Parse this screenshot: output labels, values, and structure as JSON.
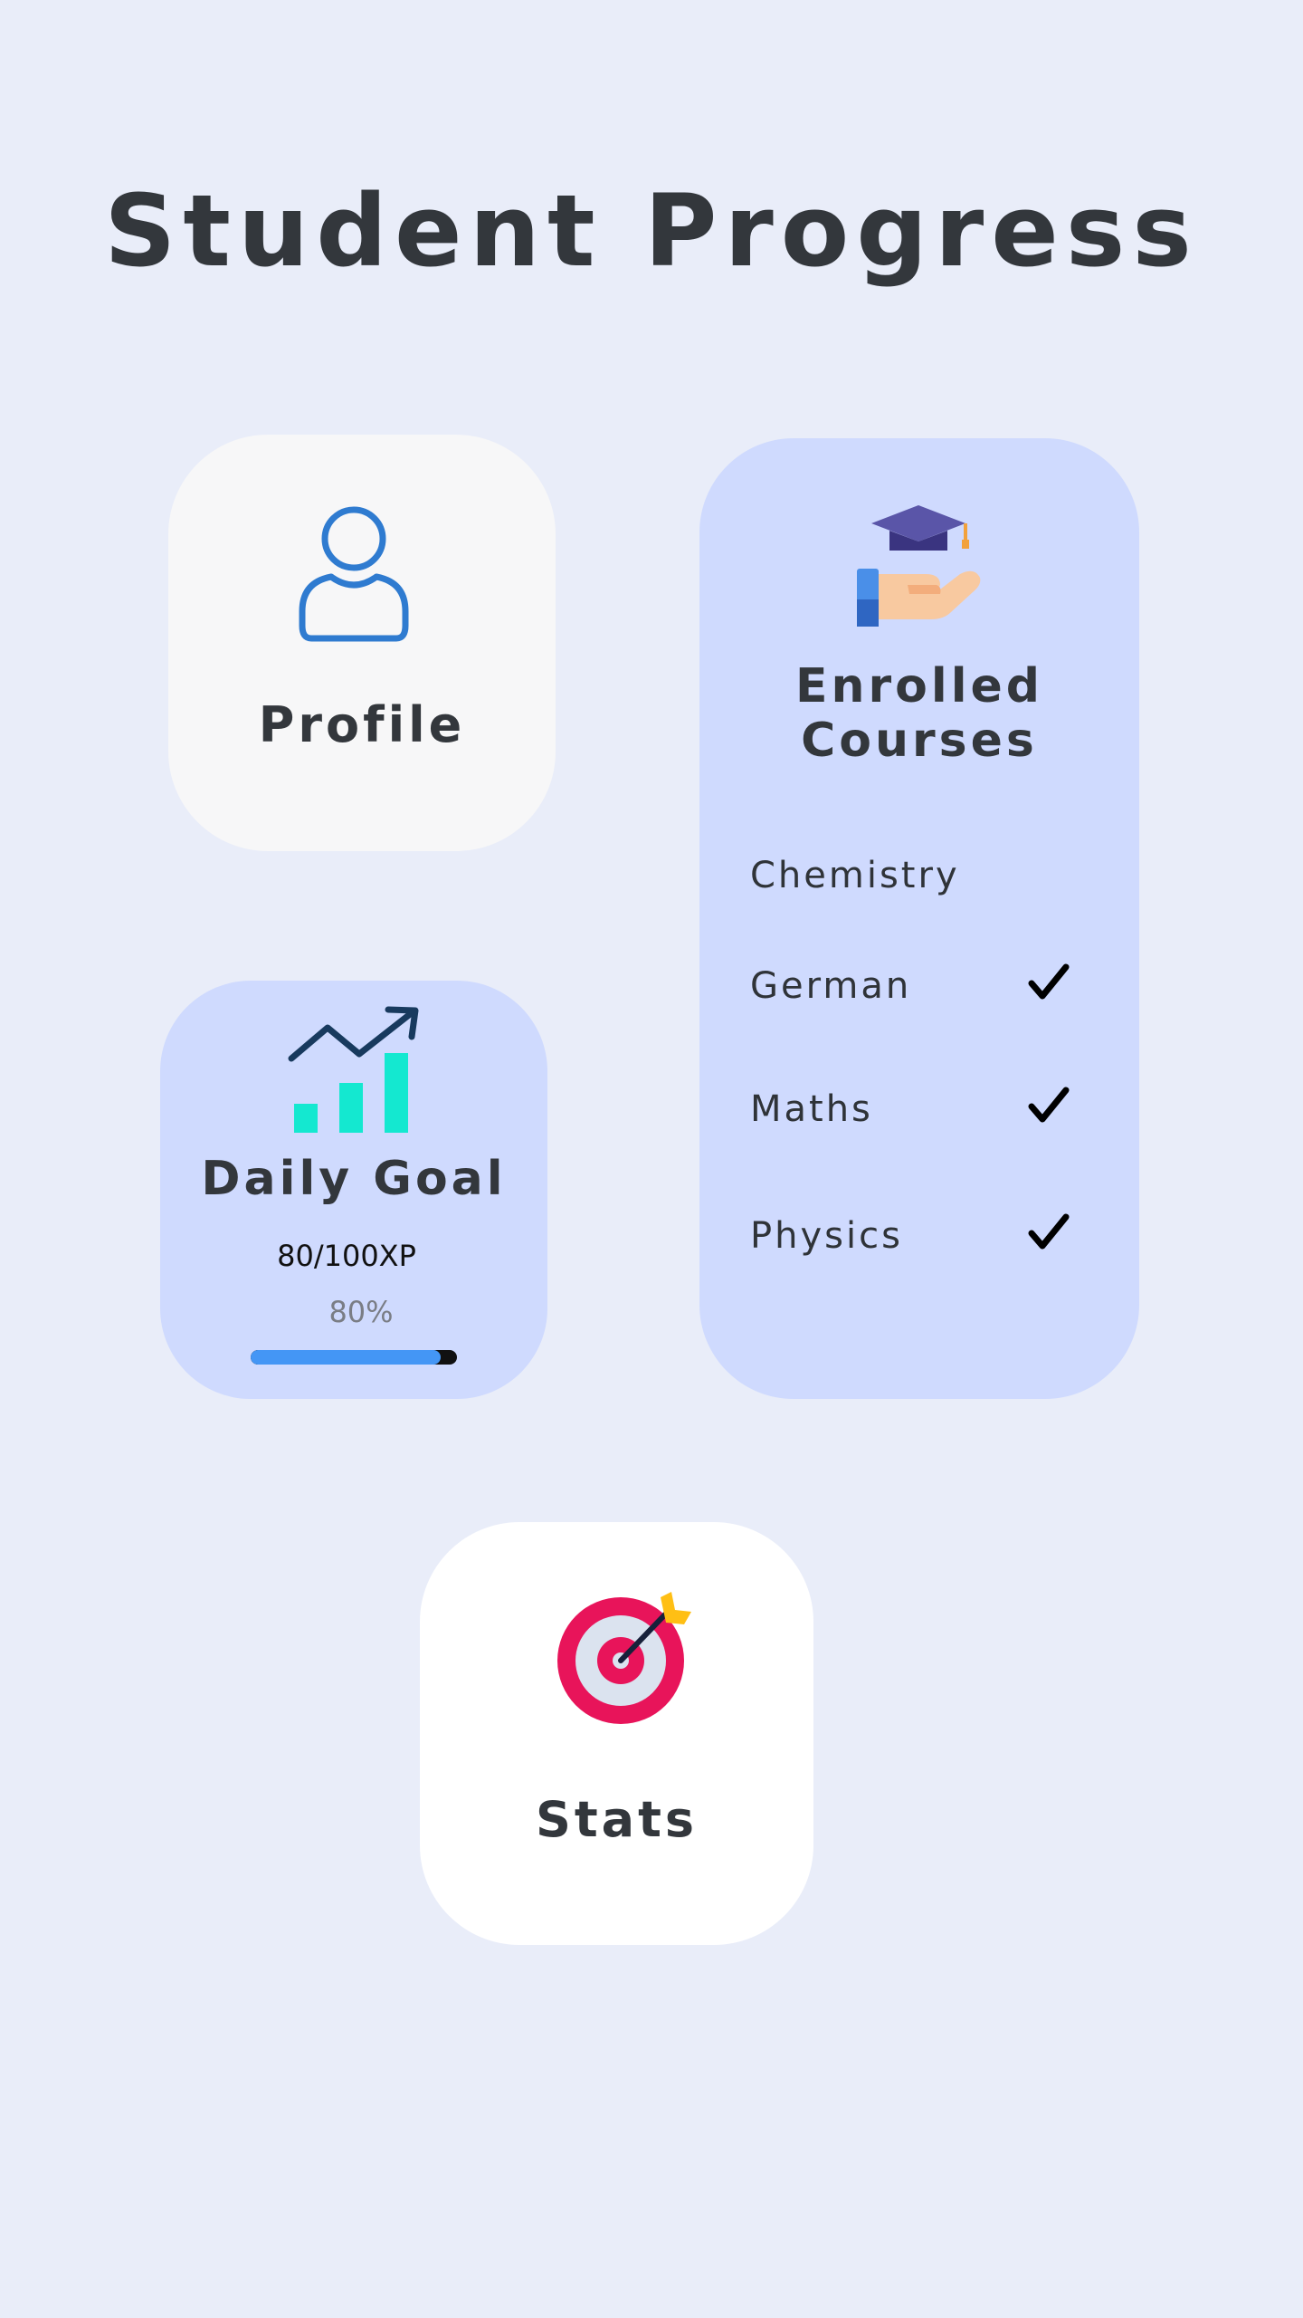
{
  "page": {
    "title": "Student Progress",
    "background_color": "#e9edf9"
  },
  "profile": {
    "label": "Profile",
    "icon": "user-icon"
  },
  "daily_goal": {
    "label": "Daily Goal",
    "icon": "growth-chart-icon",
    "xp_text": "80/100XP",
    "percent_text": "80%",
    "progress_fraction": 0.92,
    "progress_color": "#4496f5"
  },
  "enrolled_courses": {
    "label": "Enrolled Courses",
    "icon": "graduation-cap-hand-icon",
    "courses": [
      {
        "name": "Chemistry",
        "completed": false
      },
      {
        "name": "German",
        "completed": true
      },
      {
        "name": "Maths",
        "completed": true
      },
      {
        "name": "Physics",
        "completed": true
      }
    ]
  },
  "stats": {
    "label": "Stats",
    "icon": "target-icon"
  }
}
